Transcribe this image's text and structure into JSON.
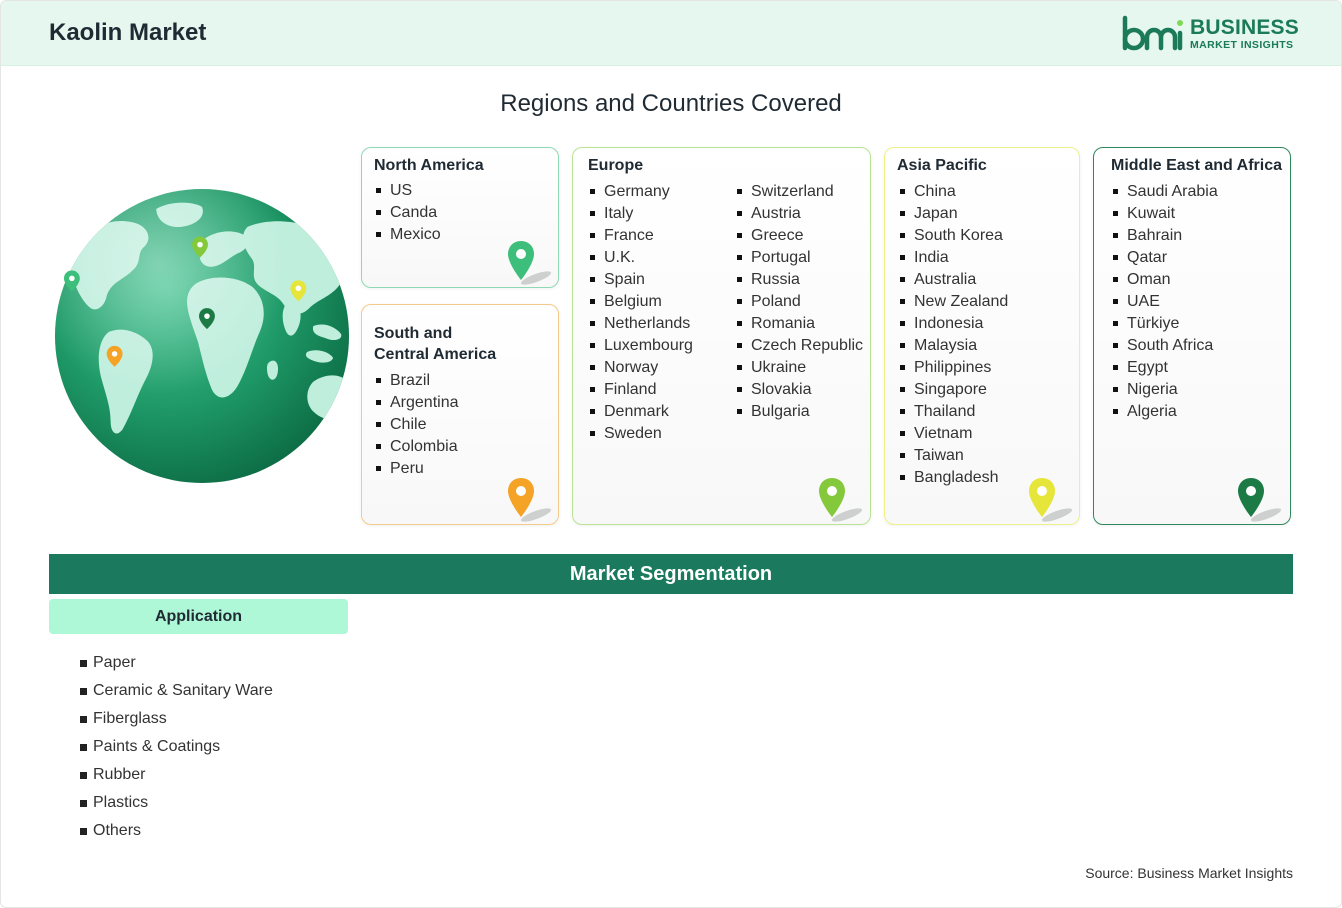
{
  "header": {
    "title": "Kaolin Market",
    "logo_line1": "BUSINESS",
    "logo_line2": "MARKET INSIGHTS"
  },
  "regions_title": "Regions and Countries Covered",
  "regions": {
    "north_america": {
      "title": "North America",
      "countries": [
        "US",
        "Canda",
        "Mexico"
      ],
      "pin_color": "#3dbf7b"
    },
    "south_america": {
      "title_line1": "South and",
      "title_line2": "Central America",
      "countries": [
        "Brazil",
        "Argentina",
        "Chile",
        "Colombia",
        "Peru"
      ],
      "pin_color": "#f4a326"
    },
    "europe": {
      "title": "Europe",
      "countries_col1": [
        "Germany",
        "Italy",
        "France",
        "U.K.",
        "Spain",
        "Belgium",
        "Netherlands",
        "Luxembourg",
        "Norway",
        "Finland",
        "Denmark",
        "Sweden"
      ],
      "countries_col2": [
        "Switzerland",
        "Austria",
        "Greece",
        "Portugal",
        "Russia",
        "Poland",
        "Romania",
        "Czech Republic",
        "Ukraine",
        "Slovakia",
        "Bulgaria"
      ],
      "pin_color": "#84c83b"
    },
    "asia_pacific": {
      "title": "Asia Pacific",
      "countries": [
        "China",
        "Japan",
        "South Korea",
        "India",
        "Australia",
        "New Zealand",
        "Indonesia",
        "Malaysia",
        "Philippines",
        "Singapore",
        "Thailand",
        "Vietnam",
        "Taiwan",
        "Bangladesh"
      ],
      "pin_color": "#e6e63a"
    },
    "middle_east_africa": {
      "title": "Middle East and Africa",
      "countries": [
        "Saudi Arabia",
        "Kuwait",
        "Bahrain",
        "Qatar",
        "Oman",
        "UAE",
        "Türkiye",
        "South Africa",
        "Egypt",
        "Nigeria",
        "Algeria"
      ],
      "pin_color": "#1c7a45"
    }
  },
  "segmentation": {
    "title": "Market Segmentation",
    "tab": "Application",
    "items": [
      "Paper",
      "Ceramic & Sanitary Ware",
      "Fiberglass",
      "Paints & Coatings",
      "Rubber",
      "Plastics",
      "Others"
    ]
  },
  "source": "Source: Business Market Insights",
  "colors": {
    "header_bg": "#e5f7ee",
    "brand_green": "#1b7a5a",
    "segmentation_bar": "#1b7a5d",
    "application_tab": "#aef7d7"
  }
}
